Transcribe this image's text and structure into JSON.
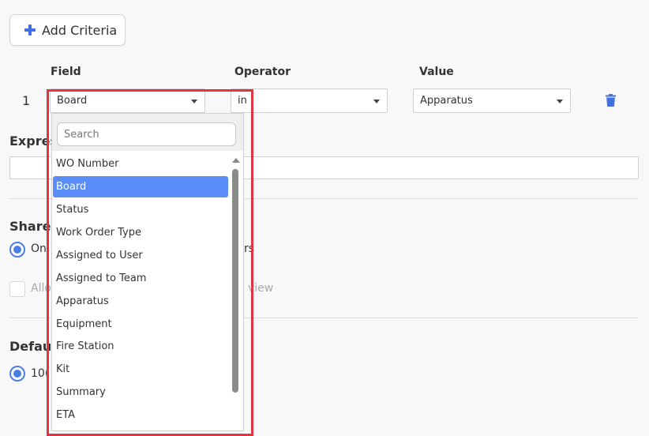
{
  "toolbar": {
    "add_criteria_label": "Add Criteria"
  },
  "columns": {
    "field": "Field",
    "operator": "Operator",
    "value": "Value"
  },
  "criteria_row": {
    "index": "1",
    "field_value": "Board",
    "operator_value": "in",
    "value_value": "Apparatus"
  },
  "sections": {
    "expression_fragment": "Expres",
    "share_fragment": "Share",
    "share_option_fragment": "On",
    "share_option_tail": "rs",
    "allow_fragment": "Allo",
    "allow_tail": "view",
    "default_fragment": "Defau",
    "default_option_fragment": "10("
  },
  "dropdown": {
    "search_placeholder": "Search",
    "options": [
      "WO Number",
      "Board",
      "Status",
      "Work Order Type",
      "Assigned to User",
      "Assigned to Team",
      "Apparatus",
      "Equipment",
      "Fire Station",
      "Kit",
      "Summary",
      "ETA"
    ],
    "selected": "Board"
  },
  "colors": {
    "accent": "#4a7de8",
    "selected_bg": "#5b8df9",
    "highlight": "#e2353f",
    "trash": "#3f6fe0"
  },
  "icons": {
    "add": "plus-icon",
    "delete": "trash-icon",
    "caret": "chevron-down-icon",
    "scroll": "scroll-up-arrow-icon"
  }
}
